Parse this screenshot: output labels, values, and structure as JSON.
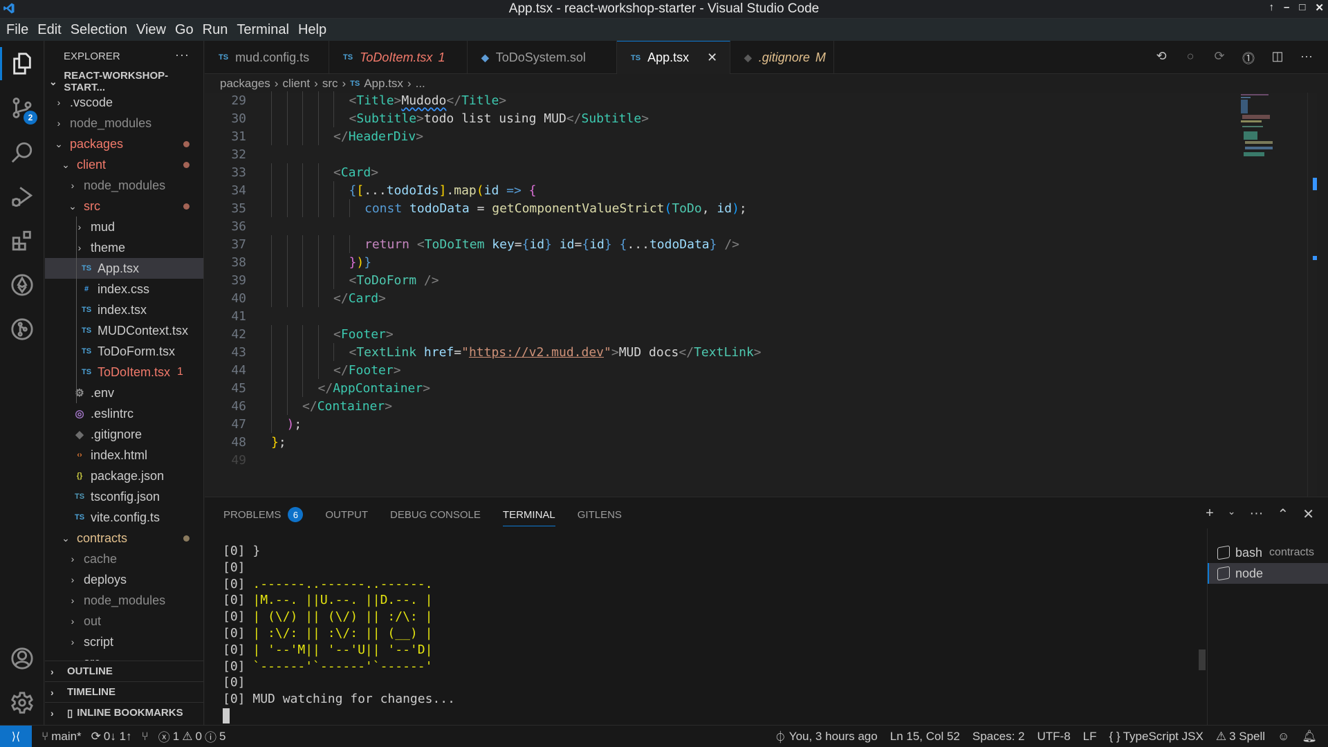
{
  "window": {
    "title": "App.tsx - react-workshop-starter - Visual Studio Code",
    "controls": [
      "up-icon",
      "minimize-icon",
      "maximize-icon",
      "close-icon"
    ]
  },
  "menu": [
    "File",
    "Edit",
    "Selection",
    "View",
    "Go",
    "Run",
    "Terminal",
    "Help"
  ],
  "activity_bar": {
    "items": [
      {
        "name": "explorer",
        "icon": "files-icon",
        "active": true
      },
      {
        "name": "source-control",
        "icon": "source-control-icon",
        "badge": "2"
      },
      {
        "name": "search",
        "icon": "search-icon"
      },
      {
        "name": "run-debug",
        "icon": "run-debug-icon"
      },
      {
        "name": "extensions",
        "icon": "extensions-icon"
      },
      {
        "name": "ethereum",
        "icon": "ethereum-icon"
      },
      {
        "name": "gitlens",
        "icon": "gitlens-icon"
      }
    ],
    "bottom": [
      {
        "name": "accounts",
        "icon": "account-icon"
      },
      {
        "name": "manage",
        "icon": "gear-icon"
      }
    ]
  },
  "sidebar": {
    "header": "EXPLORER",
    "more": "···",
    "root": "REACT-WORKSHOP-START...",
    "tree": [
      {
        "label": ".vscode",
        "type": "folder",
        "open": false,
        "depth": 1
      },
      {
        "label": "node_modules",
        "type": "folder",
        "open": false,
        "depth": 1,
        "dim": true
      },
      {
        "label": "packages",
        "type": "folder",
        "open": true,
        "depth": 1,
        "state": "err",
        "dot": true
      },
      {
        "label": "client",
        "type": "folder",
        "open": true,
        "depth": 2,
        "state": "err",
        "dot": true
      },
      {
        "label": "node_modules",
        "type": "folder",
        "open": false,
        "depth": 3,
        "dim": true
      },
      {
        "label": "src",
        "type": "folder",
        "open": true,
        "depth": 3,
        "state": "err",
        "dot": true
      },
      {
        "label": "mud",
        "type": "folder",
        "open": false,
        "depth": 4
      },
      {
        "label": "theme",
        "type": "folder",
        "open": false,
        "depth": 4
      },
      {
        "label": "App.tsx",
        "type": "ts",
        "depth": 4,
        "selected": true
      },
      {
        "label": "index.css",
        "type": "css",
        "depth": 4
      },
      {
        "label": "index.tsx",
        "type": "ts",
        "depth": 4
      },
      {
        "label": "MUDContext.tsx",
        "type": "ts",
        "depth": 4
      },
      {
        "label": "ToDoForm.tsx",
        "type": "ts",
        "depth": 4
      },
      {
        "label": "ToDoItem.tsx",
        "type": "ts",
        "depth": 4,
        "state": "err",
        "count": "1"
      },
      {
        "label": ".env",
        "type": "env",
        "depth": 3
      },
      {
        "label": ".eslintrc",
        "type": "eslint",
        "depth": 3
      },
      {
        "label": ".gitignore",
        "type": "git",
        "depth": 3
      },
      {
        "label": "index.html",
        "type": "html",
        "depth": 3
      },
      {
        "label": "package.json",
        "type": "json",
        "depth": 3
      },
      {
        "label": "tsconfig.json",
        "type": "tsconfig",
        "depth": 3
      },
      {
        "label": "vite.config.ts",
        "type": "ts",
        "depth": 3
      },
      {
        "label": "contracts",
        "type": "folder",
        "open": true,
        "depth": 2,
        "state": "mod",
        "dot": true
      },
      {
        "label": "cache",
        "type": "folder",
        "open": false,
        "depth": 3,
        "dim": true
      },
      {
        "label": "deploys",
        "type": "folder",
        "open": false,
        "depth": 3
      },
      {
        "label": "node_modules",
        "type": "folder",
        "open": false,
        "depth": 3,
        "dim": true
      },
      {
        "label": "out",
        "type": "folder",
        "open": false,
        "depth": 3,
        "dim": true
      },
      {
        "label": "script",
        "type": "folder",
        "open": false,
        "depth": 3
      },
      {
        "label": "src",
        "type": "folder",
        "open": true,
        "depth": 3
      }
    ],
    "sections": [
      "OUTLINE",
      "TIMELINE",
      "INLINE BOOKMARKS"
    ]
  },
  "tabs": [
    {
      "label": "mud.config.ts",
      "icon": "TS",
      "state": ""
    },
    {
      "label": "ToDoItem.tsx",
      "icon": "TS",
      "state": "err",
      "flag": "1",
      "italic": true
    },
    {
      "label": "ToDoSystem.sol",
      "icon": "sol",
      "state": ""
    },
    {
      "label": "App.tsx",
      "icon": "TS",
      "state": "",
      "active": true,
      "close": "✕"
    },
    {
      "label": ".gitignore",
      "icon": "git",
      "state": "mod",
      "flag": "M",
      "italic": true
    }
  ],
  "breadcrumb": [
    "packages",
    "client",
    "src",
    "App.tsx",
    "..."
  ],
  "editor": {
    "first_line": 29,
    "lines": [
      [
        [
          "i",
          5
        ],
        [
          "pun",
          "<"
        ],
        [
          "tag",
          "Title"
        ],
        [
          "pun",
          ">"
        ],
        [
          "txt",
          "Mudodo",
          "squig"
        ],
        [
          "pun",
          "</"
        ],
        [
          "tag",
          "Title"
        ],
        [
          "pun",
          ">"
        ]
      ],
      [
        [
          "i",
          5
        ],
        [
          "pun",
          "<"
        ],
        [
          "tag",
          "Subtitle"
        ],
        [
          "pun",
          ">"
        ],
        [
          "txt",
          "todo list using MUD"
        ],
        [
          "pun",
          "</"
        ],
        [
          "tag",
          "Subtitle"
        ],
        [
          "pun",
          ">"
        ]
      ],
      [
        [
          "i",
          4
        ],
        [
          "pun",
          "</"
        ],
        [
          "tag",
          "HeaderDiv"
        ],
        [
          "pun",
          ">"
        ]
      ],
      [],
      [
        [
          "i",
          4
        ],
        [
          "pun",
          "<"
        ],
        [
          "tag",
          "Card"
        ],
        [
          "pun",
          ">"
        ]
      ],
      [
        [
          "i",
          5
        ],
        [
          "kw",
          "{"
        ],
        [
          "b1",
          "["
        ],
        [
          "txt",
          "..."
        ],
        [
          "var",
          "todoIds"
        ],
        [
          "b1",
          "]"
        ],
        [
          "txt",
          "."
        ],
        [
          "fn",
          "map"
        ],
        [
          "b1",
          "("
        ],
        [
          "var",
          "id"
        ],
        [
          "txt",
          " "
        ],
        [
          "kw",
          "=>"
        ],
        [
          "txt",
          " "
        ],
        [
          "b2",
          "{"
        ]
      ],
      [
        [
          "i",
          6
        ],
        [
          "kw",
          "const"
        ],
        [
          "txt",
          " "
        ],
        [
          "var",
          "todoData"
        ],
        [
          "txt",
          " = "
        ],
        [
          "fn",
          "getComponentValueStrict"
        ],
        [
          "b3",
          "("
        ],
        [
          "cls",
          "ToDo"
        ],
        [
          "txt",
          ", "
        ],
        [
          "var",
          "id"
        ],
        [
          "b3",
          ")"
        ],
        [
          "txt",
          ";"
        ]
      ],
      [],
      [
        [
          "i",
          6
        ],
        [
          "ret",
          "return"
        ],
        [
          "txt",
          " "
        ],
        [
          "pun",
          "<"
        ],
        [
          "cls",
          "ToDoItem"
        ],
        [
          "txt",
          " "
        ],
        [
          "var",
          "key"
        ],
        [
          "txt",
          "="
        ],
        [
          "kw",
          "{"
        ],
        [
          "var",
          "id"
        ],
        [
          "kw",
          "}"
        ],
        [
          "txt",
          " "
        ],
        [
          "var",
          "id"
        ],
        [
          "txt",
          "="
        ],
        [
          "kw",
          "{"
        ],
        [
          "var",
          "id"
        ],
        [
          "kw",
          "}"
        ],
        [
          "txt",
          " "
        ],
        [
          "kw",
          "{"
        ],
        [
          "txt",
          "..."
        ],
        [
          "var",
          "todoData"
        ],
        [
          "kw",
          "}"
        ],
        [
          "txt",
          " "
        ],
        [
          "pun",
          "/>"
        ]
      ],
      [
        [
          "i",
          5
        ],
        [
          "b2",
          "}"
        ],
        [
          "b1",
          ")"
        ],
        [
          "kw",
          "}"
        ]
      ],
      [
        [
          "i",
          5
        ],
        [
          "pun",
          "<"
        ],
        [
          "cls",
          "ToDoForm"
        ],
        [
          "txt",
          " "
        ],
        [
          "pun",
          "/>"
        ]
      ],
      [
        [
          "i",
          4
        ],
        [
          "pun",
          "</"
        ],
        [
          "tag",
          "Card"
        ],
        [
          "pun",
          ">"
        ]
      ],
      [],
      [
        [
          "i",
          4
        ],
        [
          "pun",
          "<"
        ],
        [
          "tag",
          "Footer"
        ],
        [
          "pun",
          ">"
        ]
      ],
      [
        [
          "i",
          5
        ],
        [
          "pun",
          "<"
        ],
        [
          "cls",
          "TextLink"
        ],
        [
          "txt",
          " "
        ],
        [
          "var",
          "href"
        ],
        [
          "txt",
          "="
        ],
        [
          "str",
          "\""
        ],
        [
          "str",
          "https://v2.mud.dev",
          "link"
        ],
        [
          "str",
          "\""
        ],
        [
          "pun",
          ">"
        ],
        [
          "txt",
          "MUD docs"
        ],
        [
          "pun",
          "</"
        ],
        [
          "cls",
          "TextLink"
        ],
        [
          "pun",
          ">"
        ]
      ],
      [
        [
          "i",
          4
        ],
        [
          "pun",
          "</"
        ],
        [
          "tag",
          "Footer"
        ],
        [
          "pun",
          ">"
        ]
      ],
      [
        [
          "i",
          3
        ],
        [
          "pun",
          "</"
        ],
        [
          "tag",
          "AppContainer"
        ],
        [
          "pun",
          ">"
        ]
      ],
      [
        [
          "i",
          2
        ],
        [
          "pun",
          "</"
        ],
        [
          "tag",
          "Container"
        ],
        [
          "pun",
          ">"
        ]
      ],
      [
        [
          "i",
          1
        ],
        [
          "b2",
          ")"
        ],
        [
          "txt",
          ";"
        ]
      ],
      [
        [
          "i",
          0
        ],
        [
          "b1",
          "}"
        ],
        [
          "txt",
          ";"
        ]
      ],
      []
    ]
  },
  "panel": {
    "tabs": [
      {
        "label": "PROBLEMS",
        "badge": "6"
      },
      {
        "label": "OUTPUT"
      },
      {
        "label": "DEBUG CONSOLE"
      },
      {
        "label": "TERMINAL",
        "active": true
      },
      {
        "label": "GITLENS"
      }
    ],
    "actions": [
      "+",
      "⌄",
      "···",
      "^",
      "✕"
    ],
    "terminal_lines": [
      {
        "prefix": "[0] ",
        "text": "}",
        "yellow": false
      },
      {
        "prefix": "[0] ",
        "text": "",
        "yellow": false
      },
      {
        "prefix": "[0] ",
        "text": ".------..------..------.",
        "yellow": true
      },
      {
        "prefix": "[0] ",
        "text": "|M.--. ||U.--. ||D.--. |",
        "yellow": true
      },
      {
        "prefix": "[0] ",
        "text": "| (\\/) || (\\/) || :/\\: |",
        "yellow": true
      },
      {
        "prefix": "[0] ",
        "text": "| :\\/: || :\\/: || (__) |",
        "yellow": true
      },
      {
        "prefix": "[0] ",
        "text": "| '--'M|| '--'U|| '--'D|",
        "yellow": true
      },
      {
        "prefix": "[0] ",
        "text": "`------'`------'`------'",
        "yellow": true
      },
      {
        "prefix": "[0] ",
        "text": "",
        "yellow": false
      },
      {
        "prefix": "[0] ",
        "text": "MUD watching for changes...",
        "yellow": false
      }
    ],
    "terminals": [
      {
        "label": "bash",
        "sub": "contracts"
      },
      {
        "label": "node",
        "selected": true
      }
    ]
  },
  "status": {
    "branch": "main*",
    "sync": "0↓ 1↑",
    "errors": "1",
    "warnings": "0",
    "infos": "5",
    "blame": "You, 3 hours ago",
    "position": "Ln 15, Col 52",
    "spaces": "Spaces: 2",
    "encoding": "UTF-8",
    "eol": "LF",
    "language": "TypeScript JSX",
    "spell": "3 Spell"
  }
}
